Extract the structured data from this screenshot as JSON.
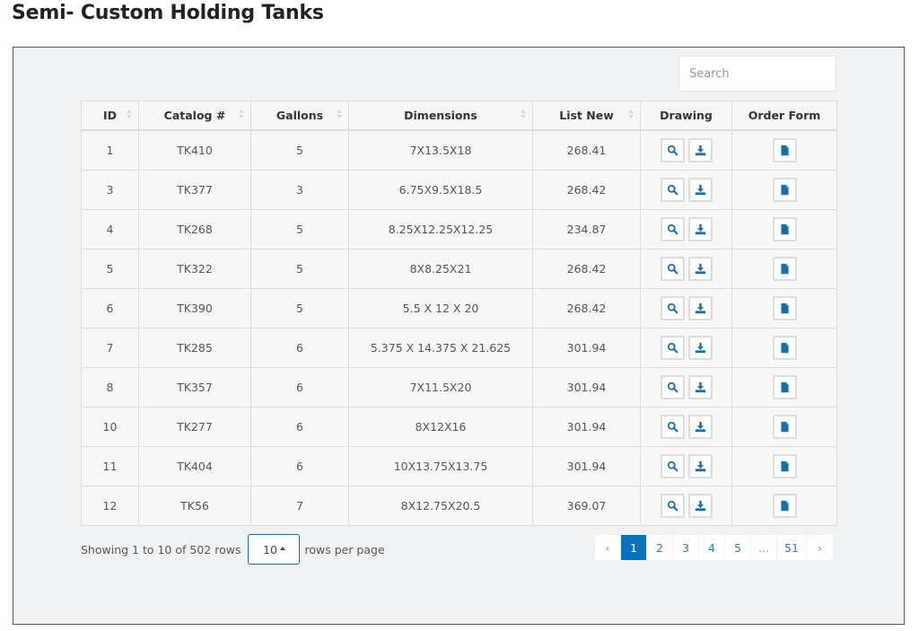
{
  "page": {
    "title": "Semi- Custom Holding Tanks"
  },
  "search": {
    "placeholder": "Search",
    "value": ""
  },
  "table": {
    "columns": [
      {
        "label": "ID",
        "sortable": true
      },
      {
        "label": "Catalog #",
        "sortable": true
      },
      {
        "label": "Gallons",
        "sortable": true
      },
      {
        "label": "Dimensions",
        "sortable": true
      },
      {
        "label": "List New",
        "sortable": true
      },
      {
        "label": "Drawing",
        "sortable": false
      },
      {
        "label": "Order Form",
        "sortable": false
      }
    ],
    "rows": [
      {
        "id": "1",
        "catalog": "TK410",
        "gallons": "5",
        "dimensions": "7X13.5X18",
        "list_new": "268.41"
      },
      {
        "id": "3",
        "catalog": "TK377",
        "gallons": "3",
        "dimensions": "6.75X9.5X18.5",
        "list_new": "268.42"
      },
      {
        "id": "4",
        "catalog": "TK268",
        "gallons": "5",
        "dimensions": "8.25X12.25X12.25",
        "list_new": "234.87"
      },
      {
        "id": "5",
        "catalog": "TK322",
        "gallons": "5",
        "dimensions": "8X8.25X21",
        "list_new": "268.42"
      },
      {
        "id": "6",
        "catalog": "TK390",
        "gallons": "5",
        "dimensions": "5.5 X 12 X 20",
        "list_new": "268.42"
      },
      {
        "id": "7",
        "catalog": "TK285",
        "gallons": "6",
        "dimensions": "5.375 X 14.375 X 21.625",
        "list_new": "301.94"
      },
      {
        "id": "8",
        "catalog": "TK357",
        "gallons": "6",
        "dimensions": "7X11.5X20",
        "list_new": "301.94"
      },
      {
        "id": "10",
        "catalog": "TK277",
        "gallons": "6",
        "dimensions": "8X12X16",
        "list_new": "301.94"
      },
      {
        "id": "11",
        "catalog": "TK404",
        "gallons": "6",
        "dimensions": "10X13.75X13.75",
        "list_new": "301.94"
      },
      {
        "id": "12",
        "catalog": "TK56",
        "gallons": "7",
        "dimensions": "8X12.75X20.5",
        "list_new": "369.07"
      }
    ],
    "row_actions": {
      "drawing": [
        "search-icon",
        "download-icon"
      ],
      "order_form": [
        "file-icon"
      ]
    }
  },
  "footer": {
    "showing_text": "Showing 1 to 10 of 502 rows",
    "rows_per_page_value": "10",
    "rows_per_page_label": "rows per page"
  },
  "pagination": {
    "prev": "‹",
    "pages": [
      "1",
      "2",
      "3",
      "4",
      "5",
      "...",
      "51"
    ],
    "active": "1",
    "next": "›"
  },
  "colors": {
    "accent": "#0b73bb",
    "icon": "#1a6ea8",
    "panel_bg": "#f1f2f4"
  }
}
